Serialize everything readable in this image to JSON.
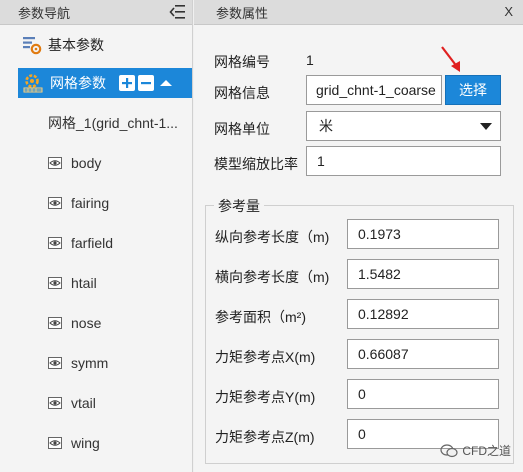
{
  "nav": {
    "title": "参数导航",
    "root_label": "基本参数",
    "selected_label": "网格参数",
    "mesh_label": "网格_1(grid_chnt-1...",
    "leaves": [
      "body",
      "fairing",
      "farfield",
      "htail",
      "nose",
      "symm",
      "vtail",
      "wing"
    ]
  },
  "props": {
    "title": "参数属性",
    "close": "X",
    "mesh_id_label": "网格编号",
    "mesh_id_value": "1",
    "mesh_info_label": "网格信息",
    "mesh_info_value": "grid_chnt-1_coarse",
    "select_button": "选择",
    "mesh_unit_label": "网格单位",
    "mesh_unit_value": "米",
    "scale_label": "模型缩放比率",
    "scale_value": "1",
    "ref_group_title": "参考量",
    "ref_rows": [
      {
        "label": "纵向参考长度（m)",
        "value": "0.1973"
      },
      {
        "label": "横向参考长度（m)",
        "value": "1.5482"
      },
      {
        "label": "参考面积（m²)",
        "value": "0.12892"
      },
      {
        "label": "力矩参考点X(m)",
        "value": "0.66087"
      },
      {
        "label": "力矩参考点Y(m)",
        "value": "0"
      },
      {
        "label": "力矩参考点Z(m)",
        "value": "0"
      }
    ]
  },
  "watermark": "CFD之道",
  "colors": {
    "accent": "#1c87d9",
    "annotation_arrow": "#e02020",
    "panel_bg": "#f4f4f4",
    "header_bg": "#dcdcdc"
  }
}
